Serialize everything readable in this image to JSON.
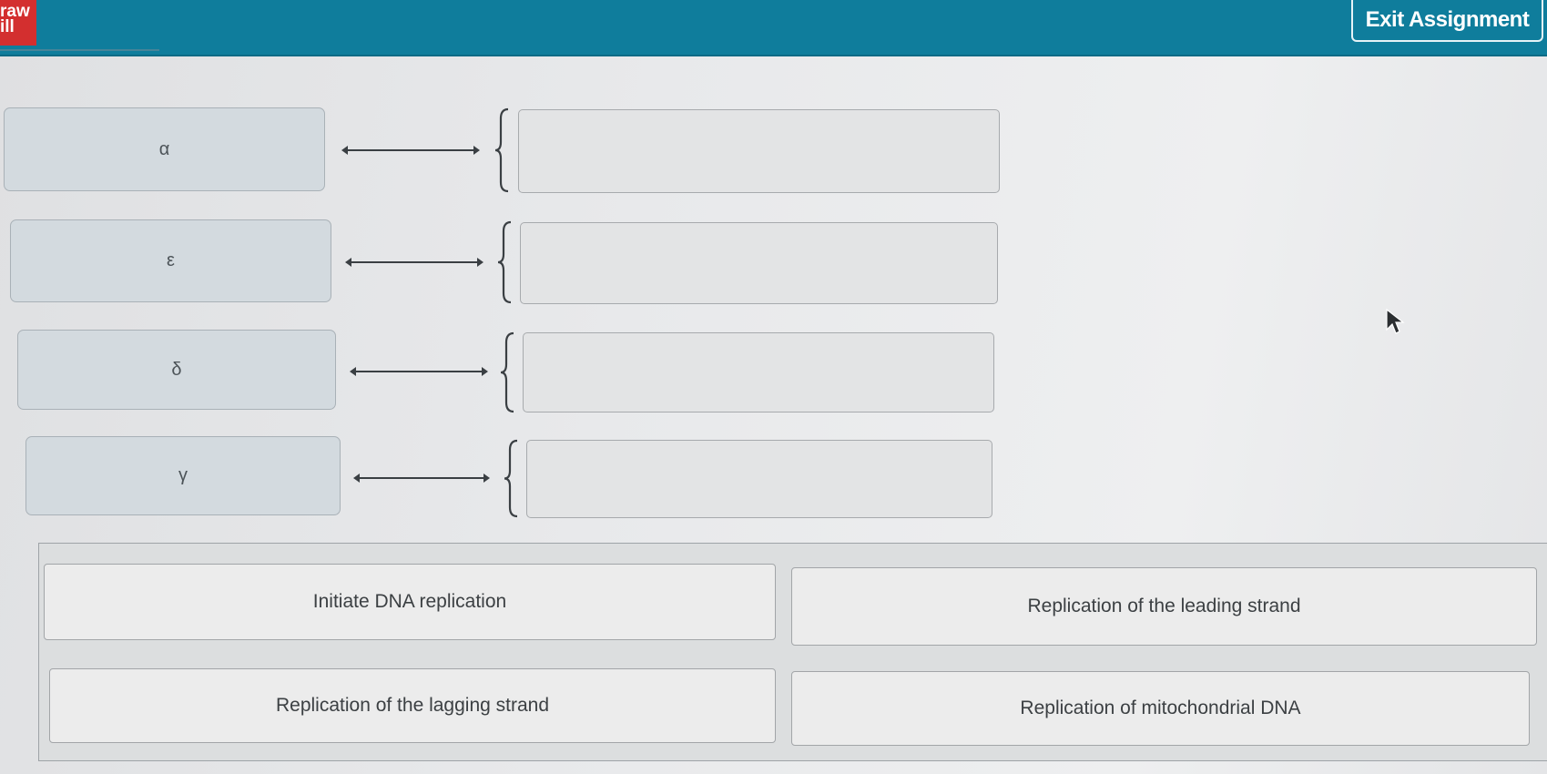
{
  "header": {
    "logo_lines": [
      "raw",
      "ill"
    ],
    "exit_label": "Exit Assignment",
    "colors": {
      "bar": "#0f7d9c",
      "logo": "#d32f2f"
    }
  },
  "matching": {
    "terms": [
      "α",
      "ε",
      "δ",
      "γ"
    ],
    "targets": [
      "",
      "",
      "",
      ""
    ]
  },
  "choices": [
    "Initiate DNA replication",
    "Replication of the leading strand",
    "Replication of the lagging strand",
    "Replication of mitochondrial DNA"
  ],
  "icons": {
    "cursor": "mouse-pointer-icon",
    "arrow": "double-arrow-icon",
    "brace": "left-brace-icon"
  }
}
